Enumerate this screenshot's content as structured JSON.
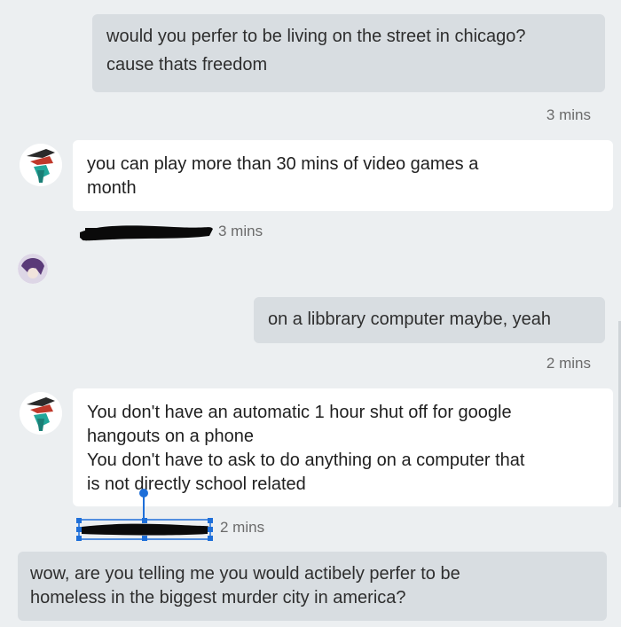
{
  "messages": [
    {
      "lines": [
        "would you perfer to be living on the street in chicago?",
        "cause thats freedom"
      ]
    },
    {
      "lines": [
        "you can play more than 30 mins of video games a",
        "month"
      ]
    },
    {
      "lines": [
        "on a libbrary computer maybe, yeah"
      ]
    },
    {
      "lines": [
        "You don't have an automatic 1 hour shut off for google",
        "hangouts on a phone",
        "You don't have to ask to do anything on a computer that",
        "is not directly school related"
      ]
    },
    {
      "lines": [
        "wow, are you telling me you would actibely perfer to be",
        "homeless in the biggest murder city in america?"
      ]
    }
  ],
  "timestamps": {
    "t1": "3 mins",
    "t2": "3 mins",
    "t3": "2 mins",
    "t4": "2 mins"
  },
  "icons": {
    "avatar_bird": "bird-avatar-icon",
    "avatar_purple": "purple-avatar-icon"
  },
  "colors": {
    "background": "#eceff1",
    "sent_bubble": "#d8dde1",
    "received_bubble": "#ffffff",
    "selection_blue": "#1e6fd9"
  }
}
